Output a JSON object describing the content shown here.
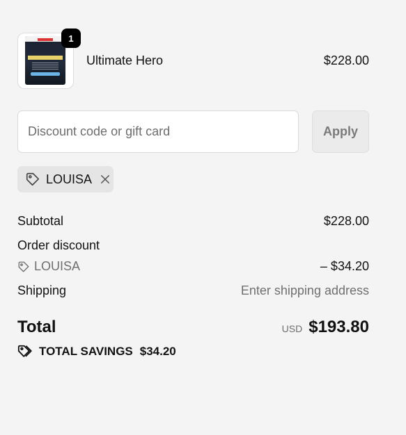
{
  "product": {
    "name": "Ultimate Hero",
    "price": "$228.00",
    "quantity": "1"
  },
  "discount": {
    "placeholder": "Discount code or gift card",
    "apply_label": "Apply",
    "applied_code": "LOUISA"
  },
  "summary": {
    "subtotal_label": "Subtotal",
    "subtotal_value": "$228.00",
    "order_discount_label": "Order discount",
    "discount_code": "LOUISA",
    "discount_value": "– $34.20",
    "shipping_label": "Shipping",
    "shipping_value": "Enter shipping address",
    "total_label": "Total",
    "currency": "USD",
    "total_value": "$193.80",
    "savings_label": "TOTAL SAVINGS",
    "savings_value": "$34.20"
  }
}
